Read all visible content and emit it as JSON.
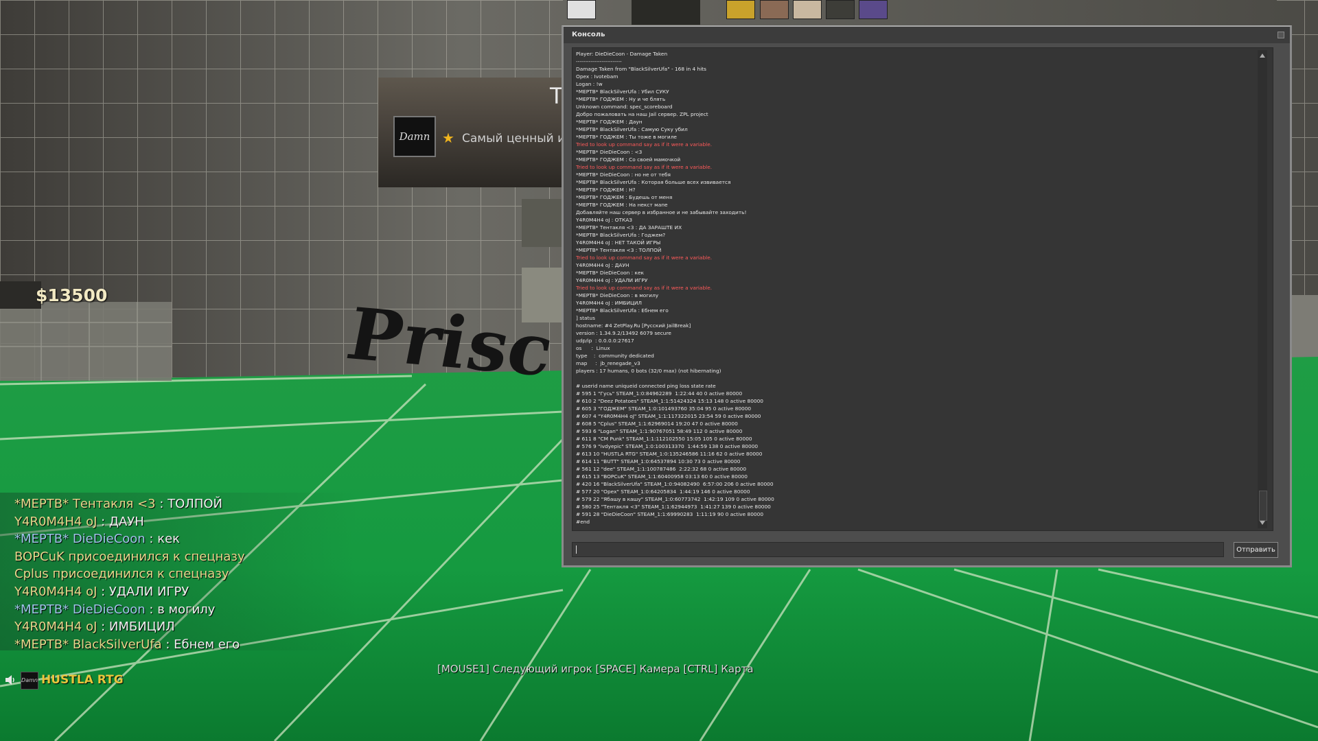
{
  "hud": {
    "money": "$13500",
    "mvp_big_letter": "T",
    "mvp_text": "Самый ценный иг",
    "mvp_avatar_text": "Damn",
    "wall_sign": "Prisc",
    "spectator_hint": "[MOUSE1] Следующий игрок [SPACE] Камера [CTRL] Карта"
  },
  "chat": [
    {
      "name": "*МЕРТВ* Тентакля <3",
      "name_class": "nm-t",
      "msg": " : ТОЛПОЙ"
    },
    {
      "name": "Y4R0M4H4 oJ",
      "name_class": "nm-t",
      "msg": " : ДАУН"
    },
    {
      "name": "*МЕРТВ* DieDieCoon",
      "name_class": "nm-ct",
      "msg": " : кек"
    },
    {
      "name": "",
      "name_class": "nm-t",
      "msg": "BOPCuK присоединился к спецназу"
    },
    {
      "name": "",
      "name_class": "nm-t",
      "msg": "Cplus присоединился к спецназу"
    },
    {
      "name": "Y4R0M4H4 oJ",
      "name_class": "nm-t",
      "msg": " : УДАЛИ ИГРУ"
    },
    {
      "name": "*МЕРТВ* DieDieCoon",
      "name_class": "nm-ct",
      "msg": " : в могилу"
    },
    {
      "name": "Y4R0M4H4 oJ",
      "name_class": "nm-t",
      "msg": " : ИМБИЦИЛ"
    },
    {
      "name": "*МЕРТВ* BlackSilverUfa",
      "name_class": "nm-t",
      "msg": " : Ебнем его"
    }
  ],
  "voice": {
    "avatar_text": "Damn",
    "speaker_name": "HUSTLA RTG",
    "icon": "speaker-icon"
  },
  "console": {
    "title": "Консоль",
    "send_label": "Отправить",
    "input_value": "",
    "lines": [
      {
        "text": "Player: DieDieCoon - Damage Taken",
        "type": "normal"
      },
      {
        "text": "-------------------------",
        "type": "normal"
      },
      {
        "text": "Damage Taken from \"BlackSilverUfa\" - 168 in 4 hits",
        "type": "normal"
      },
      {
        "text": "Opex : Ivotebam",
        "type": "normal"
      },
      {
        "text": "Logan : !w",
        "type": "normal"
      },
      {
        "text": "*МЕРТВ* BlackSilverUfa : Убил СУКУ",
        "type": "normal"
      },
      {
        "text": "*МЕРТВ* ГОДЖЕМ : Ну и че блять",
        "type": "normal"
      },
      {
        "text": "Unknown command: spec_scoreboard",
        "type": "normal"
      },
      {
        "text": "Добро пожаловать на наш Jail сервер. ZPL project",
        "type": "normal"
      },
      {
        "text": "*МЕРТВ* ГОДЖЕМ : Даун",
        "type": "normal"
      },
      {
        "text": "*МЕРТВ* BlackSilverUfa : Самую Суку убил",
        "type": "normal"
      },
      {
        "text": "*МЕРТВ* ГОДЖЕМ : Ты тоже в могиле",
        "type": "normal"
      },
      {
        "text": "Tried to look up command say as if it were a variable.",
        "type": "err"
      },
      {
        "text": "*МЕРТВ* DieDieCoon : <3",
        "type": "normal"
      },
      {
        "text": "*МЕРТВ* ГОДЖЕМ : Со своей мамочкой",
        "type": "normal"
      },
      {
        "text": "Tried to look up command say as if it were a variable.",
        "type": "err"
      },
      {
        "text": "*МЕРТВ* DieDieCoon : но не от тебя",
        "type": "normal"
      },
      {
        "text": "*МЕРТВ* BlackSilverUfa : Которая больше всех извивается",
        "type": "normal"
      },
      {
        "text": "*МЕРТВ* ГОДЖЕМ : Н?",
        "type": "normal"
      },
      {
        "text": "*МЕРТВ* ГОДЖЕМ : Будешь от меня",
        "type": "normal"
      },
      {
        "text": "*МЕРТВ* ГОДЖЕМ : На некст мапе",
        "type": "normal"
      },
      {
        "text": "Добавляйте наш сервер в избранное и не забывайте заходить!",
        "type": "normal"
      },
      {
        "text": "Y4R0M4H4 oJ : ОТКАЗ",
        "type": "normal"
      },
      {
        "text": "*МЕРТВ* Тентакля <3 : ДА ЗАРАШТЕ ИХ",
        "type": "normal"
      },
      {
        "text": "*МЕРТВ* BlackSilverUfa : Годжем?",
        "type": "normal"
      },
      {
        "text": "Y4R0M4H4 oJ : НЕТ ТАКОЙ ИГРЫ",
        "type": "normal"
      },
      {
        "text": "*МЕРТВ* Тентакля <3 : ТОЛПОЙ",
        "type": "normal"
      },
      {
        "text": "Tried to look up command say as if it were a variable.",
        "type": "err"
      },
      {
        "text": "Y4R0M4H4 oJ : ДАУН",
        "type": "normal"
      },
      {
        "text": "*МЕРТВ* DieDieCoon : кек",
        "type": "normal"
      },
      {
        "text": "Y4R0M4H4 oJ : УДАЛИ ИГРУ",
        "type": "normal"
      },
      {
        "text": "Tried to look up command say as if it were a variable.",
        "type": "err"
      },
      {
        "text": "*МЕРТВ* DieDieCoon : в могилу",
        "type": "normal"
      },
      {
        "text": "Y4R0M4H4 oJ : ИМБИЦИЛ",
        "type": "normal"
      },
      {
        "text": "*МЕРТВ* BlackSilverUfa : Ебнем его",
        "type": "normal"
      },
      {
        "text": "] status",
        "type": "normal"
      },
      {
        "text": "hostname: #4 ZetPlay.Ru [Русский JailBreak]",
        "type": "normal"
      },
      {
        "text": "version : 1.34.9.2/13492 6079 secure",
        "type": "normal"
      },
      {
        "text": "udp/ip  : 0.0.0.0:27617",
        "type": "normal"
      },
      {
        "text": "os      :  Linux",
        "type": "normal"
      },
      {
        "text": "type    :  community dedicated",
        "type": "normal"
      },
      {
        "text": "map     :  jb_renegade_v3",
        "type": "normal"
      },
      {
        "text": "players : 17 humans, 0 bots (32/0 max) (not hibernating)",
        "type": "normal"
      },
      {
        "text": "",
        "type": "normal"
      },
      {
        "text": "# userid name uniqueid connected ping loss state rate",
        "type": "normal"
      },
      {
        "text": "# 595 1 \"Гусь\" STEAM_1:0:84962289  1:22:44 40 0 active 80000",
        "type": "normal"
      },
      {
        "text": "# 610 2 \"Deez Potatoes\" STEAM_1:1:51424324 15:13 148 0 active 80000",
        "type": "normal"
      },
      {
        "text": "# 605 3 \"ГОДЖЕМ\" STEAM_1:0:101493760 35:04 95 0 active 80000",
        "type": "normal"
      },
      {
        "text": "# 607 4 \"Y4R0M4H4 oJ\" STEAM_1:1:117322015 23:54 59 0 active 80000",
        "type": "normal"
      },
      {
        "text": "# 608 5 \"Cplus\" STEAM_1:1:62969014 19:20 47 0 active 80000",
        "type": "normal"
      },
      {
        "text": "# 593 6 \"Logan\" STEAM_1:1:90767051 58:49 112 0 active 80000",
        "type": "normal"
      },
      {
        "text": "# 611 8 \"CM Punk\" STEAM_1:1:112102550 15:05 105 0 active 80000",
        "type": "normal"
      },
      {
        "text": "# 576 9 \"ivdyepic\" STEAM_1:0:100313370  1:44:59 138 0 active 80000",
        "type": "normal"
      },
      {
        "text": "# 613 10 \"HUSTLA RTG\" STEAM_1:0:135246586 11:16 62 0 active 80000",
        "type": "normal"
      },
      {
        "text": "# 614 11 \"BUTT\" STEAM_1:0:64537894 10:30 73 0 active 80000",
        "type": "normal"
      },
      {
        "text": "# 561 12 \"dee\" STEAM_1:1:100787486  2:22:32 68 0 active 80000",
        "type": "normal"
      },
      {
        "text": "# 615 13 \"BOPCuK\" STEAM_1:1:60400958 03:13 60 0 active 80000",
        "type": "normal"
      },
      {
        "text": "# 420 16 \"BlackSilverUfa\" STEAM_1:0:94082490  6:57:00 206 0 active 80000",
        "type": "normal"
      },
      {
        "text": "# 577 20 \"Opex\" STEAM_1:0:64205834  1:44:19 146 0 active 80000",
        "type": "normal"
      },
      {
        "text": "# 579 22 \"Ябашу в кашу\" STEAM_1:0:60773742  1:42:19 109 0 active 80000",
        "type": "normal"
      },
      {
        "text": "# 580 25 \"Тентакля <3\" STEAM_1:1:62944973  1:41:27 139 0 active 80000",
        "type": "normal"
      },
      {
        "text": "# 591 28 \"DieDieCoon\" STEAM_1:1:69990283  1:11:19 90 0 active 80000",
        "type": "normal"
      },
      {
        "text": "#end",
        "type": "normal"
      }
    ]
  }
}
